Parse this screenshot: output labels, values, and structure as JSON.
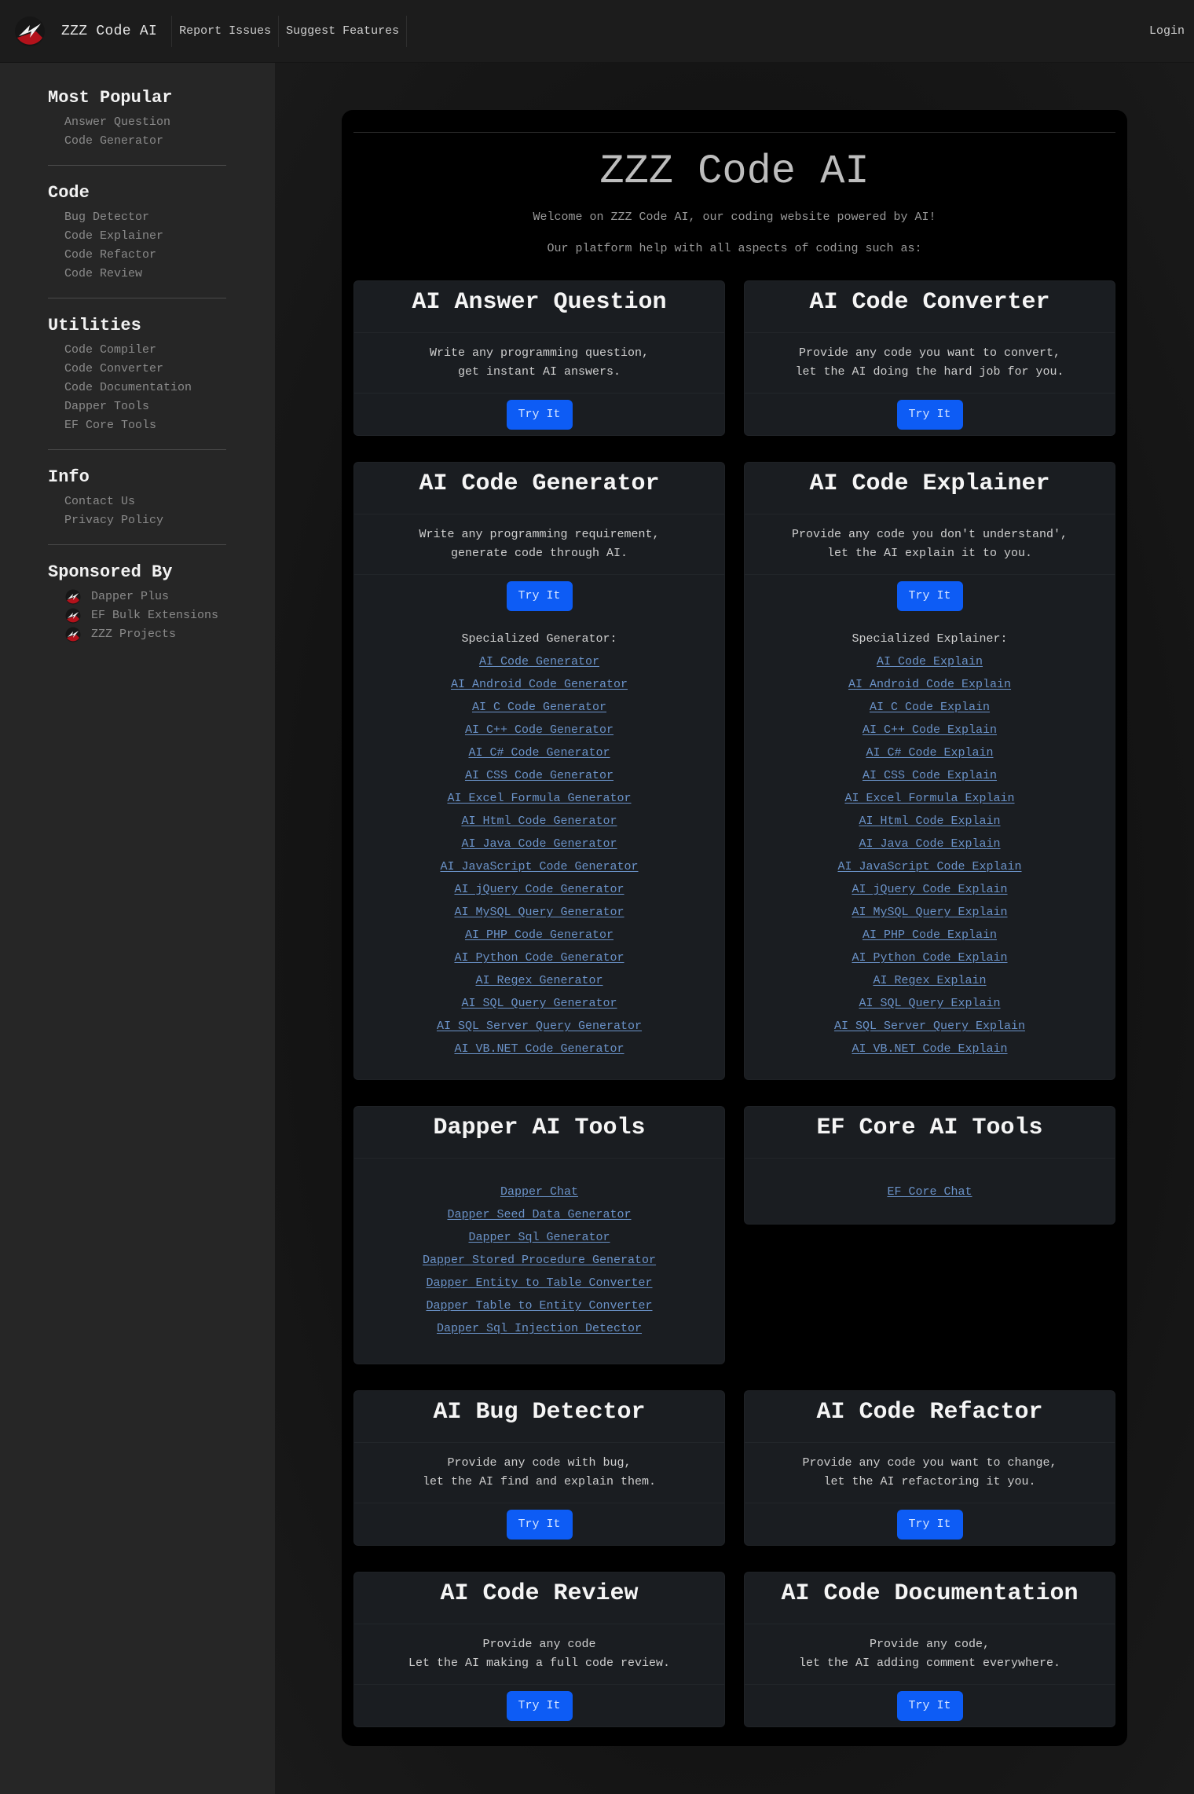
{
  "header": {
    "brand": "ZZZ Code AI",
    "nav": [
      "Report Issues",
      "Suggest Features"
    ],
    "login": "Login"
  },
  "sidebar": {
    "sections": [
      {
        "title": "Most Popular",
        "items": [
          "Answer Question",
          "Code Generator"
        ]
      },
      {
        "title": "Code",
        "items": [
          "Bug Detector",
          "Code Explainer",
          "Code Refactor",
          "Code Review"
        ]
      },
      {
        "title": "Utilities",
        "items": [
          "Code Compiler",
          "Code Converter",
          "Code Documentation",
          "Dapper Tools",
          "EF Core Tools"
        ]
      },
      {
        "title": "Info",
        "items": [
          "Contact Us",
          "Privacy Policy"
        ]
      }
    ],
    "sponsored": {
      "title": "Sponsored By",
      "items": [
        "Dapper Plus",
        "EF Bulk Extensions",
        "ZZZ Projects"
      ]
    }
  },
  "hero": {
    "title": "ZZZ Code AI",
    "welcome": "Welcome on ZZZ Code AI, our coding website powered by AI!",
    "subtitle": "Our platform help with all aspects of coding such as:"
  },
  "cards": {
    "answer": {
      "title": "AI Answer Question",
      "line1": "Write any programming question,",
      "line2": "get instant AI answers.",
      "button": "Try It"
    },
    "converter": {
      "title": "AI Code Converter",
      "line1": "Provide any code you want to convert,",
      "line2": "let the AI doing the hard job for you.",
      "button": "Try It"
    },
    "generator": {
      "title": "AI Code Generator",
      "line1": "Write any programming requirement,",
      "line2": "generate code through AI.",
      "button": "Try It",
      "spec_title": "Specialized Generator:",
      "links": [
        "AI Code Generator",
        "AI Android Code Generator",
        "AI C Code Generator",
        "AI C++ Code Generator",
        "AI C# Code Generator",
        "AI CSS Code Generator",
        "AI Excel Formula Generator",
        "AI Html Code Generator",
        "AI Java Code Generator",
        "AI JavaScript Code Generator",
        "AI jQuery Code Generator",
        "AI MySQL Query Generator",
        "AI PHP Code Generator",
        "AI Python Code Generator",
        "AI Regex Generator",
        "AI SQL Query Generator",
        "AI SQL Server Query Generator",
        "AI VB.NET Code Generator"
      ]
    },
    "explainer": {
      "title": "AI Code Explainer",
      "line1": "Provide any code you don't understand',",
      "line2": "let the AI explain it to you.",
      "button": "Try It",
      "spec_title": "Specialized Explainer:",
      "links": [
        "AI Code Explain",
        "AI Android Code Explain",
        "AI C Code Explain",
        "AI C++ Code Explain",
        "AI C# Code Explain",
        "AI CSS Code Explain",
        "AI Excel Formula Explain",
        "AI Html Code Explain",
        "AI Java Code Explain",
        "AI JavaScript Code Explain",
        "AI jQuery Code Explain",
        "AI MySQL Query Explain",
        "AI PHP Code Explain",
        "AI Python Code Explain",
        "AI Regex Explain",
        "AI SQL Query Explain",
        "AI SQL Server Query Explain",
        "AI VB.NET Code Explain"
      ]
    },
    "dapper": {
      "title": "Dapper AI Tools",
      "links": [
        "Dapper Chat",
        "Dapper Seed Data Generator",
        "Dapper Sql Generator",
        "Dapper Stored Procedure Generator",
        "Dapper Entity to Table Converter",
        "Dapper Table to Entity Converter",
        "Dapper Sql Injection Detector"
      ]
    },
    "efcore": {
      "title": "EF Core AI Tools",
      "links": [
        "EF Core Chat"
      ]
    },
    "bug": {
      "title": "AI Bug Detector",
      "line1": "Provide any code with bug,",
      "line2": "let the AI find and explain them.",
      "button": "Try It"
    },
    "refactor": {
      "title": "AI Code Refactor",
      "line1": "Provide any code you want to change,",
      "line2": "let the AI refactoring it you.",
      "button": "Try It"
    },
    "review": {
      "title": "AI Code Review",
      "line1": "Provide any code",
      "line2": "Let the AI making a full code review.",
      "button": "Try It"
    },
    "documentation": {
      "title": "AI Code Documentation",
      "line1": "Provide any code,",
      "line2": "let the AI adding comment everywhere.",
      "button": "Try It"
    }
  },
  "colors": {
    "accent_button": "#0d5cf5",
    "link": "#6b93c9",
    "card_bg": "#1a1d21",
    "sidebar_bg": "#262626",
    "header_bg": "#1c1c1c"
  },
  "icons": {
    "logo": "zzz-lightning-logo"
  }
}
